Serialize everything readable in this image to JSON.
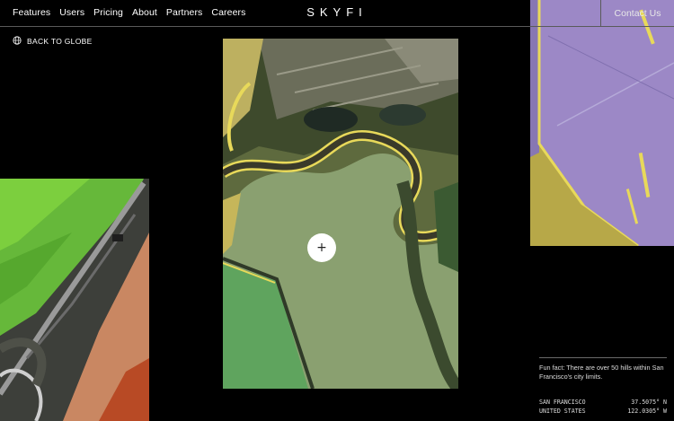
{
  "nav": {
    "items": [
      {
        "label": "Features"
      },
      {
        "label": "Users"
      },
      {
        "label": "Pricing"
      },
      {
        "label": "About"
      },
      {
        "label": "Partners"
      },
      {
        "label": "Careers"
      }
    ]
  },
  "brand": {
    "logo": "SKYFI"
  },
  "header": {
    "contact_label": "Contact Us"
  },
  "back": {
    "label": "BACK TO GLOBE",
    "icon": "globe-icon"
  },
  "zoom": {
    "symbol": "+",
    "icon": "plus-icon"
  },
  "fact": {
    "text": "Fun fact: There are over 50 hills within San Francisco's city limits."
  },
  "location": {
    "city": "SAN FRANCISCO",
    "country": "UNITED STATES",
    "lat": "37.5075° N",
    "lon": "122.0305° W"
  },
  "colors": {
    "background": "#000000",
    "main_pond": "#8aa070",
    "left_field": "#6ec23a",
    "left_salt": "#c98762",
    "right_pond": "#9c88c6",
    "levee": "#e8d95a"
  }
}
